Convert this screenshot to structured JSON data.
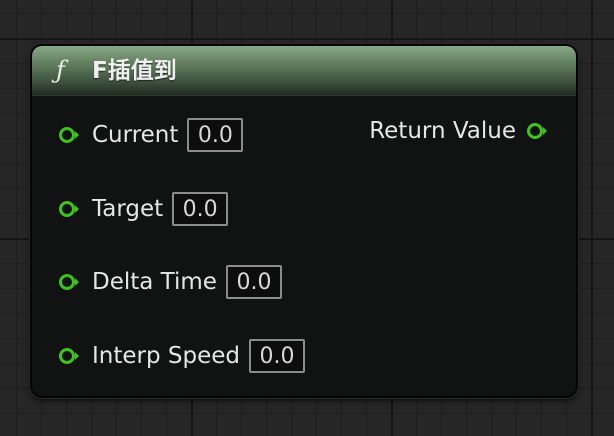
{
  "node": {
    "title": "F插值到",
    "icon": "function-icon",
    "icon_glyph": "ƒ",
    "accent_color": "#5d7a5c",
    "pin_color": "#3ec41a",
    "inputs": [
      {
        "label": "Current",
        "value": "0.0"
      },
      {
        "label": "Target",
        "value": "0.0"
      },
      {
        "label": "Delta Time",
        "value": "0.0"
      },
      {
        "label": "Interp Speed",
        "value": "0.0"
      }
    ],
    "output": {
      "label": "Return Value"
    }
  }
}
